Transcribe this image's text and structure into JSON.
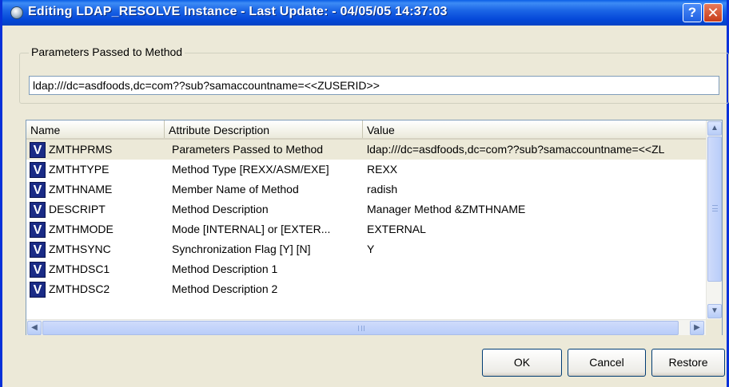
{
  "window": {
    "title": "Editing LDAP_RESOLVE Instance - Last Update: - 04/05/05 14:37:03",
    "help_label": "?",
    "close_label": "✕"
  },
  "params": {
    "group_label": "Parameters Passed to Method",
    "value": "ldap:///dc=asdfoods,dc=com??sub?samaccountname=<<ZUSERID>>"
  },
  "table": {
    "columns": [
      "Name",
      "Attribute Description",
      "Value"
    ],
    "row_icon": "V",
    "rows": [
      {
        "name": "ZMTHPRMS",
        "attr": "Parameters Passed to Method",
        "value": "ldap:///dc=asdfoods,dc=com??sub?samaccountname=<<ZL"
      },
      {
        "name": "ZMTHTYPE",
        "attr": "Method Type [REXX/ASM/EXE]",
        "value": "REXX"
      },
      {
        "name": "ZMTHNAME",
        "attr": "Member Name of Method",
        "value": "radish"
      },
      {
        "name": "DESCRIPT",
        "attr": "Method Description",
        "value": "Manager Method &ZMTHNAME"
      },
      {
        "name": "ZMTHMODE",
        "attr": "Mode [INTERNAL] or [EXTER...",
        "value": "EXTERNAL"
      },
      {
        "name": "ZMTHSYNC",
        "attr": "Synchronization Flag [Y] [N]",
        "value": "Y"
      },
      {
        "name": "ZMTHDSC1",
        "attr": "Method Description 1",
        "value": ""
      },
      {
        "name": "ZMTHDSC2",
        "attr": "Method Description 2",
        "value": ""
      }
    ]
  },
  "buttons": {
    "ok": "OK",
    "cancel": "Cancel",
    "restore": "Restore"
  },
  "icons": {
    "title": "app-icon",
    "row": "v-variable-icon",
    "scroll_up": "▲",
    "scroll_down": "▼",
    "scroll_left": "◀",
    "scroll_right": "▶"
  }
}
